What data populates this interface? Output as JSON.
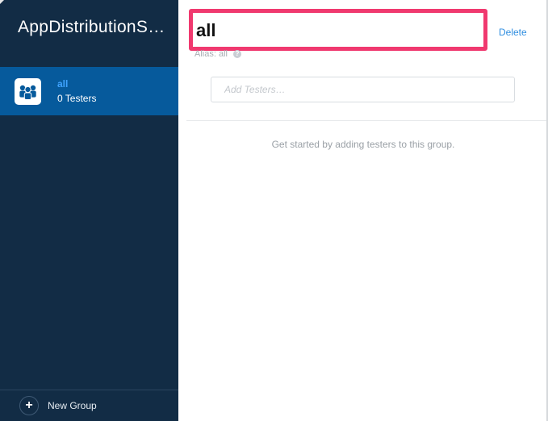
{
  "sidebar": {
    "app_title": "AppDistributionS…",
    "groups": [
      {
        "name": "all",
        "count": "0 Testers",
        "icon": "group-icon"
      }
    ],
    "new_group_label": "New Group",
    "new_group_icon": "+"
  },
  "main": {
    "group_name_value": "all",
    "delete_label": "Delete",
    "alias_text": "Alias: all",
    "help_icon": "?",
    "add_testers_placeholder": "Add Testers…",
    "empty_message": "Get started by adding testers to this group."
  },
  "colors": {
    "sidebar_bg": "#122c45",
    "selected_bg": "#065a9c",
    "accent_link": "#2f8ee0",
    "highlight_border": "#f0396f"
  }
}
